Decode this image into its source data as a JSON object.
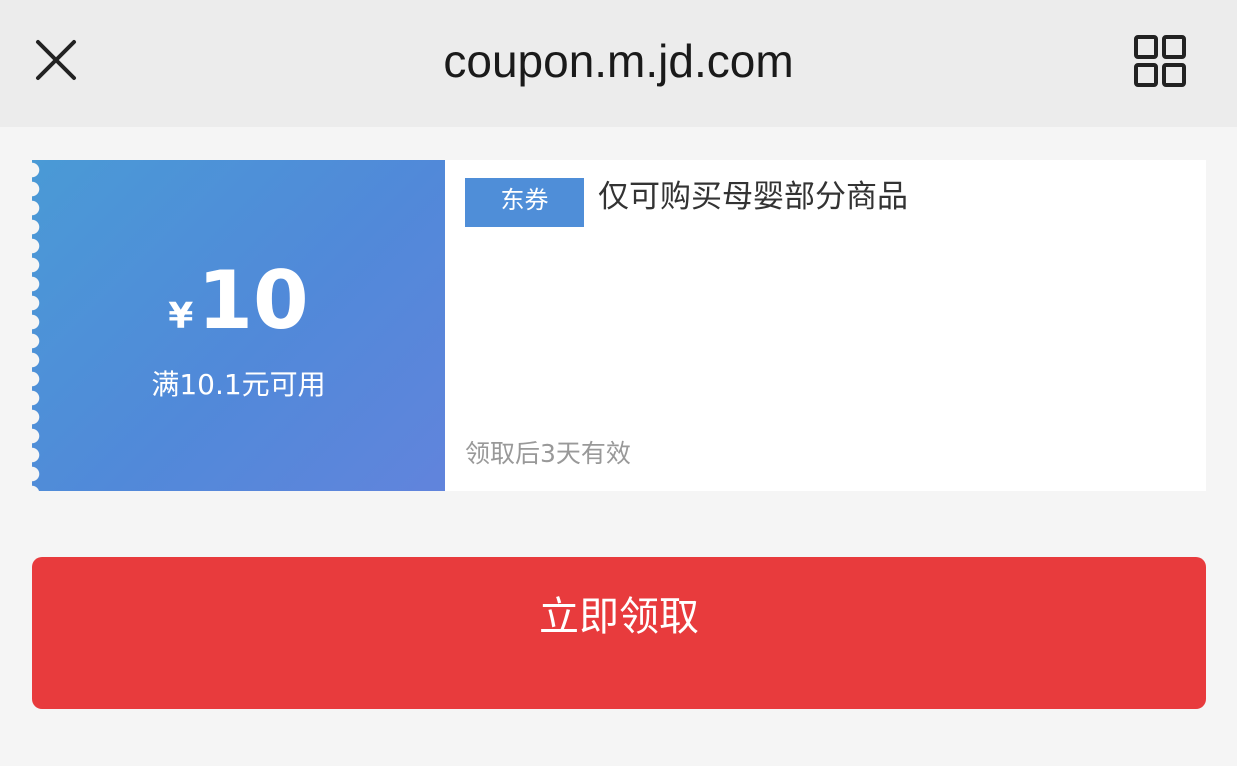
{
  "header": {
    "title": "coupon.m.jd.com",
    "close_icon": "close-icon",
    "menu_icon": "grid-menu-icon"
  },
  "coupon": {
    "currency": "¥",
    "amount": "10",
    "condition": "满10.1元可用",
    "tag": "东券",
    "description": "仅可购买母婴部分商品",
    "validity": "领取后3天有效"
  },
  "action": {
    "claim_label": "立即领取"
  },
  "colors": {
    "coupon_blue": "#5189d9",
    "tag_blue": "#4f8ed8",
    "button_red": "#e83b3d",
    "topbar_bg": "#ececec",
    "page_bg": "#f5f5f5"
  }
}
